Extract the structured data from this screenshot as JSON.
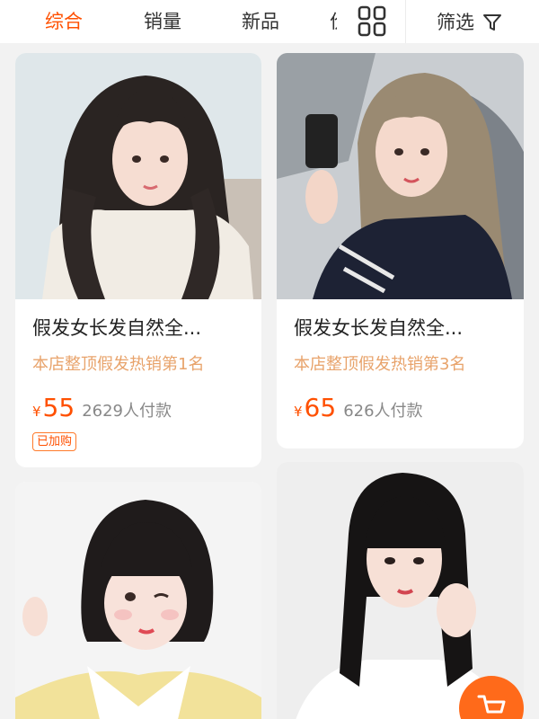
{
  "sort_bar": {
    "tabs": [
      {
        "label": "综合",
        "active": true
      },
      {
        "label": "销量",
        "active": false
      },
      {
        "label": "新品",
        "active": false
      }
    ],
    "truncated_tab": "价",
    "filter_label": "筛选"
  },
  "products": [
    {
      "title": "假发女长发自然全...",
      "subtitle": "本店整顶假发热销第1名",
      "currency": "¥",
      "price": "55",
      "sold": "2629人付款",
      "badge": "已加购"
    },
    {
      "title": "假发女长发自然全...",
      "subtitle": "本店整顶假发热销第3名",
      "currency": "¥",
      "price": "65",
      "sold": "626人付款"
    }
  ],
  "colors": {
    "accent": "#ff5000",
    "subtitle": "#e8a36b",
    "sold": "#888888"
  }
}
